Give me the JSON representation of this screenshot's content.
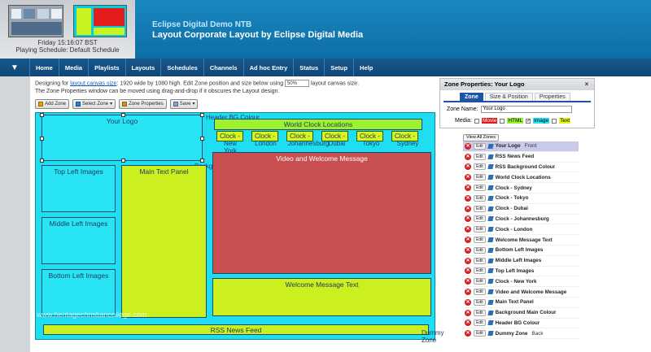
{
  "header": {
    "clock": "Friday 15:16:07 BST",
    "schedule": "Playing Schedule: Default Schedule",
    "title1": "Eclipse Digital Demo NTB",
    "title2": "Layout Corporate Layout by Eclipse Digital Media"
  },
  "nav": {
    "arrow": "▼",
    "items": [
      "Home",
      "Media",
      "Playlists",
      "Layouts",
      "Schedules",
      "Channels",
      "Ad hoc Entry",
      "Status",
      "Setup",
      "Help"
    ]
  },
  "description": {
    "line1_pre": "Designing for ",
    "link": "layout canvas size",
    "line1_mid": ": 1920 wide by 1080 high. Edit Zone position and size below using ",
    "zoom": "50%",
    "line1_post": " layout canvas size.",
    "line2": "The Zone Properties window can be moved using drag-and-drop if it obscures the Layout design."
  },
  "toolbar": {
    "add_zone": "Add Zone",
    "select_zone": "Select Zone",
    "zone_properties": "Zone Properties",
    "save": "Save"
  },
  "canvas": {
    "your_logo": "Your Logo",
    "header_bg": "Header BG Colour",
    "world_clock": "World Clock Locations",
    "clock_label": "Clock -",
    "cities": [
      "New York",
      "London",
      "Johannesburg",
      "Dubai",
      "Tokyo",
      "Sydney"
    ],
    "background_main": "Background Main Colour",
    "video_welcome": "Video and Welcome Message",
    "top_left": "Top Left Images",
    "main_text": "Main Text Panel",
    "middle_left": "Middle Left Images",
    "bottom_left": "Bottom Left Images",
    "welcome_text": "Welcome Message Text",
    "rss": "RSS News Feed",
    "dummy": "Dummy Zone",
    "watermark": "www.heritagechristiancollege.com"
  },
  "zone_properties": {
    "title": "Zone Properties: Your Logo",
    "close": "×",
    "tabs": [
      "Zone",
      "Size & Position",
      "Properties"
    ],
    "zone_name_label": "Zone Name:",
    "zone_name_value": "Your Logo",
    "media_label": "Media:",
    "media_movie": "Movie",
    "media_html": "HTML",
    "media_image": "Image",
    "media_text": "Text",
    "colors": {
      "movie": "#d61c1c",
      "html": "#9df230",
      "image": "#28e4f4",
      "text": "#e6f21f",
      "accent": "#1d54a6"
    }
  },
  "zone_list": {
    "view_all": "View All Zones",
    "delete_icon": "✕",
    "edit_label": "Edit",
    "items": [
      {
        "name": "Your Logo",
        "suffix": "Front"
      },
      {
        "name": "RSS News Feed",
        "suffix": ""
      },
      {
        "name": "RSS Background Colour",
        "suffix": ""
      },
      {
        "name": "World Clock Locations",
        "suffix": ""
      },
      {
        "name": "Clock - Sydney",
        "suffix": ""
      },
      {
        "name": "Clock - Tokyo",
        "suffix": ""
      },
      {
        "name": "Clock - Dubai",
        "suffix": ""
      },
      {
        "name": "Clock - Johannesburg",
        "suffix": ""
      },
      {
        "name": "Clock - London",
        "suffix": ""
      },
      {
        "name": "Welcome Message Text",
        "suffix": ""
      },
      {
        "name": "Bottom Left Images",
        "suffix": ""
      },
      {
        "name": "Middle Left Images",
        "suffix": ""
      },
      {
        "name": "Top Left Images",
        "suffix": ""
      },
      {
        "name": "Clock - New York",
        "suffix": ""
      },
      {
        "name": "Video and Welcome Message",
        "suffix": ""
      },
      {
        "name": "Main Text Panel",
        "suffix": ""
      },
      {
        "name": "Background Main Colour",
        "suffix": ""
      },
      {
        "name": "Header BG Colour",
        "suffix": ""
      },
      {
        "name": "Dummy Zone",
        "suffix": "Back"
      }
    ]
  }
}
